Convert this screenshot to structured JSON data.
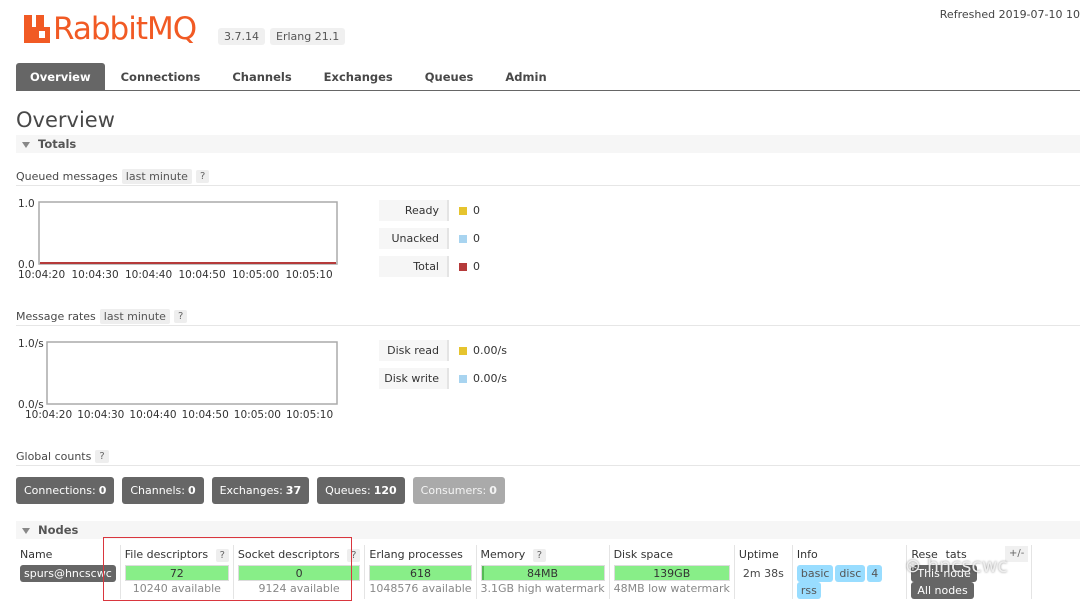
{
  "header": {
    "brand": "RabbitMQ",
    "version": "3.7.14",
    "erlang": "Erlang 21.1",
    "refreshed": "Refreshed 2019-07-10 10"
  },
  "tabs": [
    "Overview",
    "Connections",
    "Channels",
    "Exchanges",
    "Queues",
    "Admin"
  ],
  "page_title": "Overview",
  "totals": {
    "heading": "Totals",
    "queued_messages": {
      "label": "Queued messages",
      "range": "last minute",
      "help": "?",
      "y_top": "1.0",
      "y_bottom": "0.0",
      "x_ticks": [
        "10:04:20",
        "10:04:30",
        "10:04:40",
        "10:04:50",
        "10:05:00",
        "10:05:10"
      ],
      "legend": [
        {
          "label": "Ready",
          "value": "0",
          "color": "#e6c42e"
        },
        {
          "label": "Unacked",
          "value": "0",
          "color": "#a8d4f0"
        },
        {
          "label": "Total",
          "value": "0",
          "color": "#b53a3a"
        }
      ]
    },
    "message_rates": {
      "label": "Message rates",
      "range": "last minute",
      "help": "?",
      "y_top": "1.0/s",
      "y_bottom": "0.0/s",
      "x_ticks": [
        "10:04:20",
        "10:04:30",
        "10:04:40",
        "10:04:50",
        "10:05:00",
        "10:05:10"
      ],
      "legend": [
        {
          "label": "Disk read",
          "value": "0.00/s",
          "color": "#e6c42e"
        },
        {
          "label": "Disk write",
          "value": "0.00/s",
          "color": "#a8d4f0"
        }
      ]
    },
    "global_counts": {
      "label": "Global counts",
      "help": "?",
      "items": [
        {
          "label": "Connections:",
          "value": "0"
        },
        {
          "label": "Channels:",
          "value": "0"
        },
        {
          "label": "Exchanges:",
          "value": "37"
        },
        {
          "label": "Queues:",
          "value": "120"
        },
        {
          "label": "Consumers:",
          "value": "0"
        }
      ]
    }
  },
  "nodes": {
    "heading": "Nodes",
    "columns": {
      "name": "Name",
      "fd": "File descriptors",
      "sd": "Socket descriptors",
      "erlang": "Erlang processes",
      "memory": "Memory",
      "disk": "Disk space",
      "uptime": "Uptime",
      "info": "Info",
      "reset": "Rese",
      "reset_tail": "tats",
      "plusminus": "+/-"
    },
    "row": {
      "name": "spurs@hncscwc",
      "fd": "72",
      "fd_sub": "10240 available",
      "sd": "0",
      "sd_sub": "9124 available",
      "erlang": "618",
      "erlang_sub": "1048576 available",
      "memory": "84MB",
      "memory_sub": "3.1GB high watermark",
      "disk": "139GB",
      "disk_sub": "48MB low watermark",
      "uptime": "2m 38s",
      "info": [
        "basic",
        "disc",
        "4",
        "rss"
      ],
      "this_node": "This node",
      "all_nodes": "All nodes"
    }
  },
  "watermark": "hncscwc"
}
